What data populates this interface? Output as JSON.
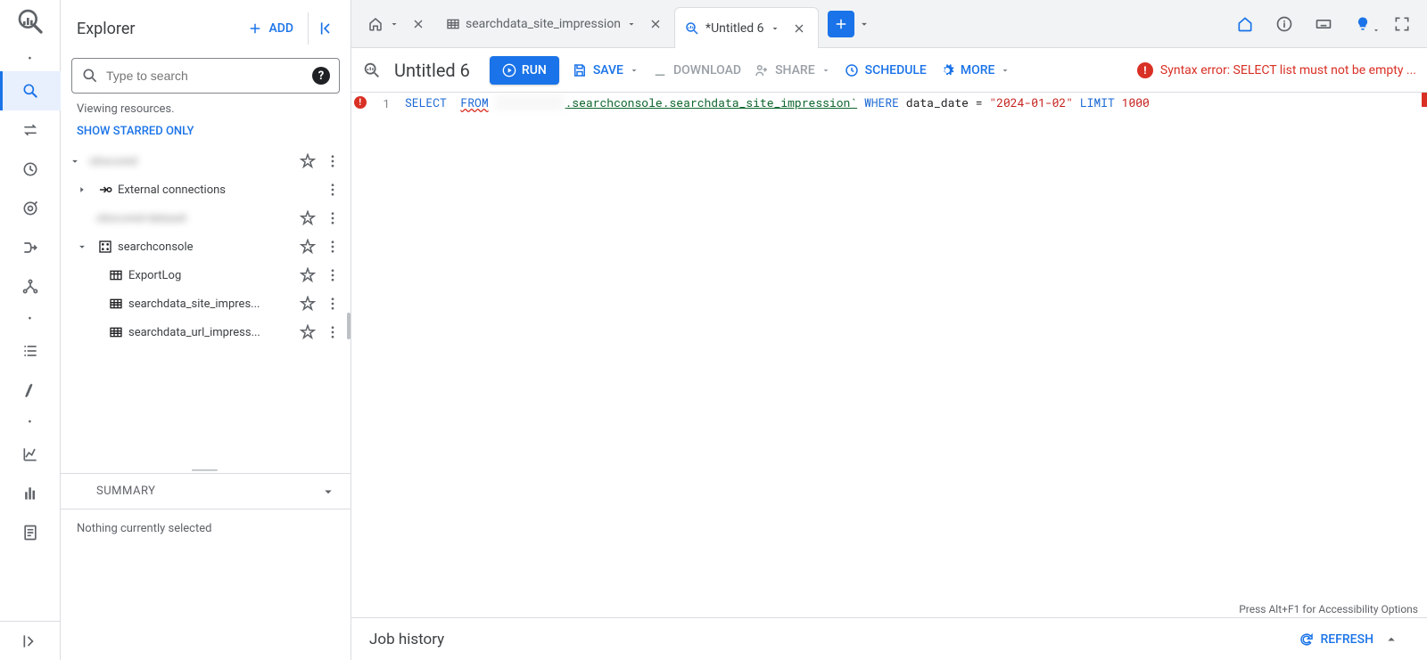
{
  "explorer": {
    "title": "Explorer",
    "add_label": "ADD",
    "search_placeholder": "Type to search",
    "status": "Viewing resources.",
    "starred_link": "SHOW STARRED ONLY",
    "tree": {
      "project": "obscured",
      "external": "External connections",
      "dataset0": "obscured-dataset",
      "dataset1": "searchconsole",
      "table0": "ExportLog",
      "table1": "searchdata_site_impres...",
      "table2": "searchdata_url_impress..."
    },
    "summary_label": "SUMMARY",
    "summary_body": "Nothing currently selected"
  },
  "tabs": {
    "t1": "searchdata_site_impression",
    "t2": "*Untitled 6"
  },
  "toolbar": {
    "title": "Untitled 6",
    "run": "RUN",
    "save": "SAVE",
    "download": "DOWNLOAD",
    "share": "SHARE",
    "schedule": "SCHEDULE",
    "more": "MORE",
    "error": "Syntax error: SELECT list must not be empty ..."
  },
  "code": {
    "ln": "1",
    "select": "SELECT",
    "from": "FROM",
    "hidden": "          ",
    "table": ".searchconsole.searchdata_site_impression`",
    "where": "WHERE",
    "cond": "data_date = ",
    "date": "\"2024-01-02\"",
    "limit": "LIMIT",
    "limitnum": "1000",
    "accessibility": "Press Alt+F1 for Accessibility Options"
  },
  "jobhist": {
    "title": "Job history",
    "refresh": "REFRESH"
  }
}
